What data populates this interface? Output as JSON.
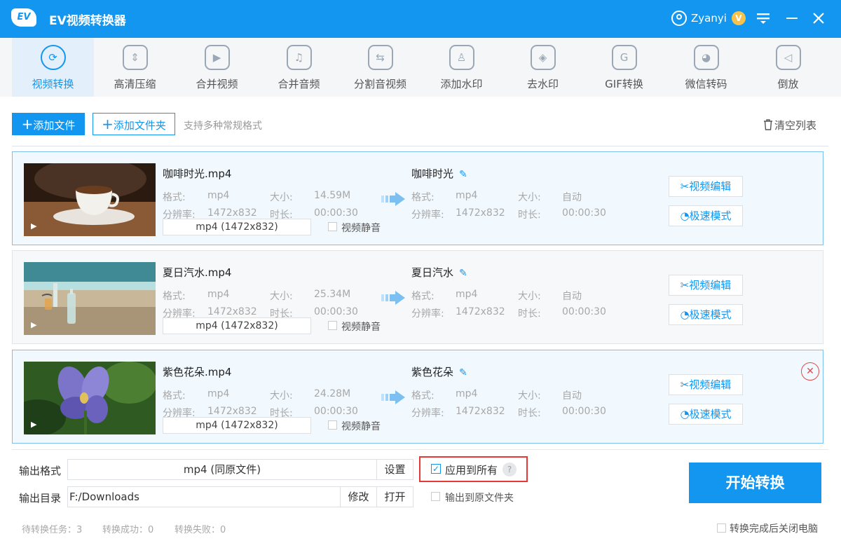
{
  "app": {
    "logo": "EV",
    "title": "EV视频转换器"
  },
  "user": {
    "name": "Zyanyi",
    "badge": "V"
  },
  "tools": [
    {
      "label": "视频转换",
      "icon": "refresh-play-icon",
      "glyph": "⟳"
    },
    {
      "label": "高清压缩",
      "icon": "compress-icon",
      "glyph": "⇕"
    },
    {
      "label": "合并视频",
      "icon": "merge-video-icon",
      "glyph": "▶"
    },
    {
      "label": "合并音频",
      "icon": "merge-audio-icon",
      "glyph": "♫"
    },
    {
      "label": "分割音视频",
      "icon": "split-icon",
      "glyph": "⇆"
    },
    {
      "label": "添加水印",
      "icon": "stamp-icon",
      "glyph": "♙"
    },
    {
      "label": "去水印",
      "icon": "drop-icon",
      "glyph": "◈"
    },
    {
      "label": "GIF转换",
      "icon": "gif-icon",
      "glyph": "G"
    },
    {
      "label": "微信转码",
      "icon": "wechat-icon",
      "glyph": "◕"
    },
    {
      "label": "倒放",
      "icon": "reverse-play-icon",
      "glyph": "◁"
    }
  ],
  "actions": {
    "add_file": "添加文件",
    "add_folder": "添加文件夹",
    "support": "支持多种常规格式",
    "clear": "清空列表"
  },
  "labels": {
    "format": "格式:",
    "size": "大小:",
    "resolution": "分辨率:",
    "duration": "时长:",
    "mute": "视频静音",
    "edit": "视频编辑",
    "speed": "极速模式"
  },
  "files": [
    {
      "name": "咖啡时光.mp4",
      "format": "mp4",
      "size": "14.59M",
      "resolution": "1472x832",
      "duration": "00:00:30",
      "select": "mp4 (1472x832)",
      "out_name": "咖啡时光",
      "out_format": "mp4",
      "out_size": "自动",
      "out_resolution": "1472x832",
      "out_duration": "00:00:30"
    },
    {
      "name": "夏日汽水.mp4",
      "format": "mp4",
      "size": "25.34M",
      "resolution": "1472x832",
      "duration": "00:00:30",
      "select": "mp4 (1472x832)",
      "out_name": "夏日汽水",
      "out_format": "mp4",
      "out_size": "自动",
      "out_resolution": "1472x832",
      "out_duration": "00:00:30"
    },
    {
      "name": "紫色花朵.mp4",
      "format": "mp4",
      "size": "24.28M",
      "resolution": "1472x832",
      "duration": "00:00:30",
      "select": "mp4 (1472x832)",
      "out_name": "紫色花朵",
      "out_format": "mp4",
      "out_size": "自动",
      "out_resolution": "1472x832",
      "out_duration": "00:00:30"
    }
  ],
  "output": {
    "format_label": "输出格式",
    "format_value": "mp4 (同原文件)",
    "settings": "设置",
    "dir_label": "输出目录",
    "dir_value": "F:/Downloads",
    "modify": "修改",
    "open": "打开",
    "apply_all": "应用到所有",
    "apply_all_checked": true,
    "help": "?",
    "to_source": "输出到原文件夹",
    "start": "开始转换",
    "shutdown": "转换完成后关闭电脑"
  },
  "status": {
    "pending": "待转换任务：3",
    "success": "转换成功：0",
    "failed": "转换失败：0"
  },
  "colors": {
    "accent": "#1296f0",
    "highlight": "#e53935"
  }
}
